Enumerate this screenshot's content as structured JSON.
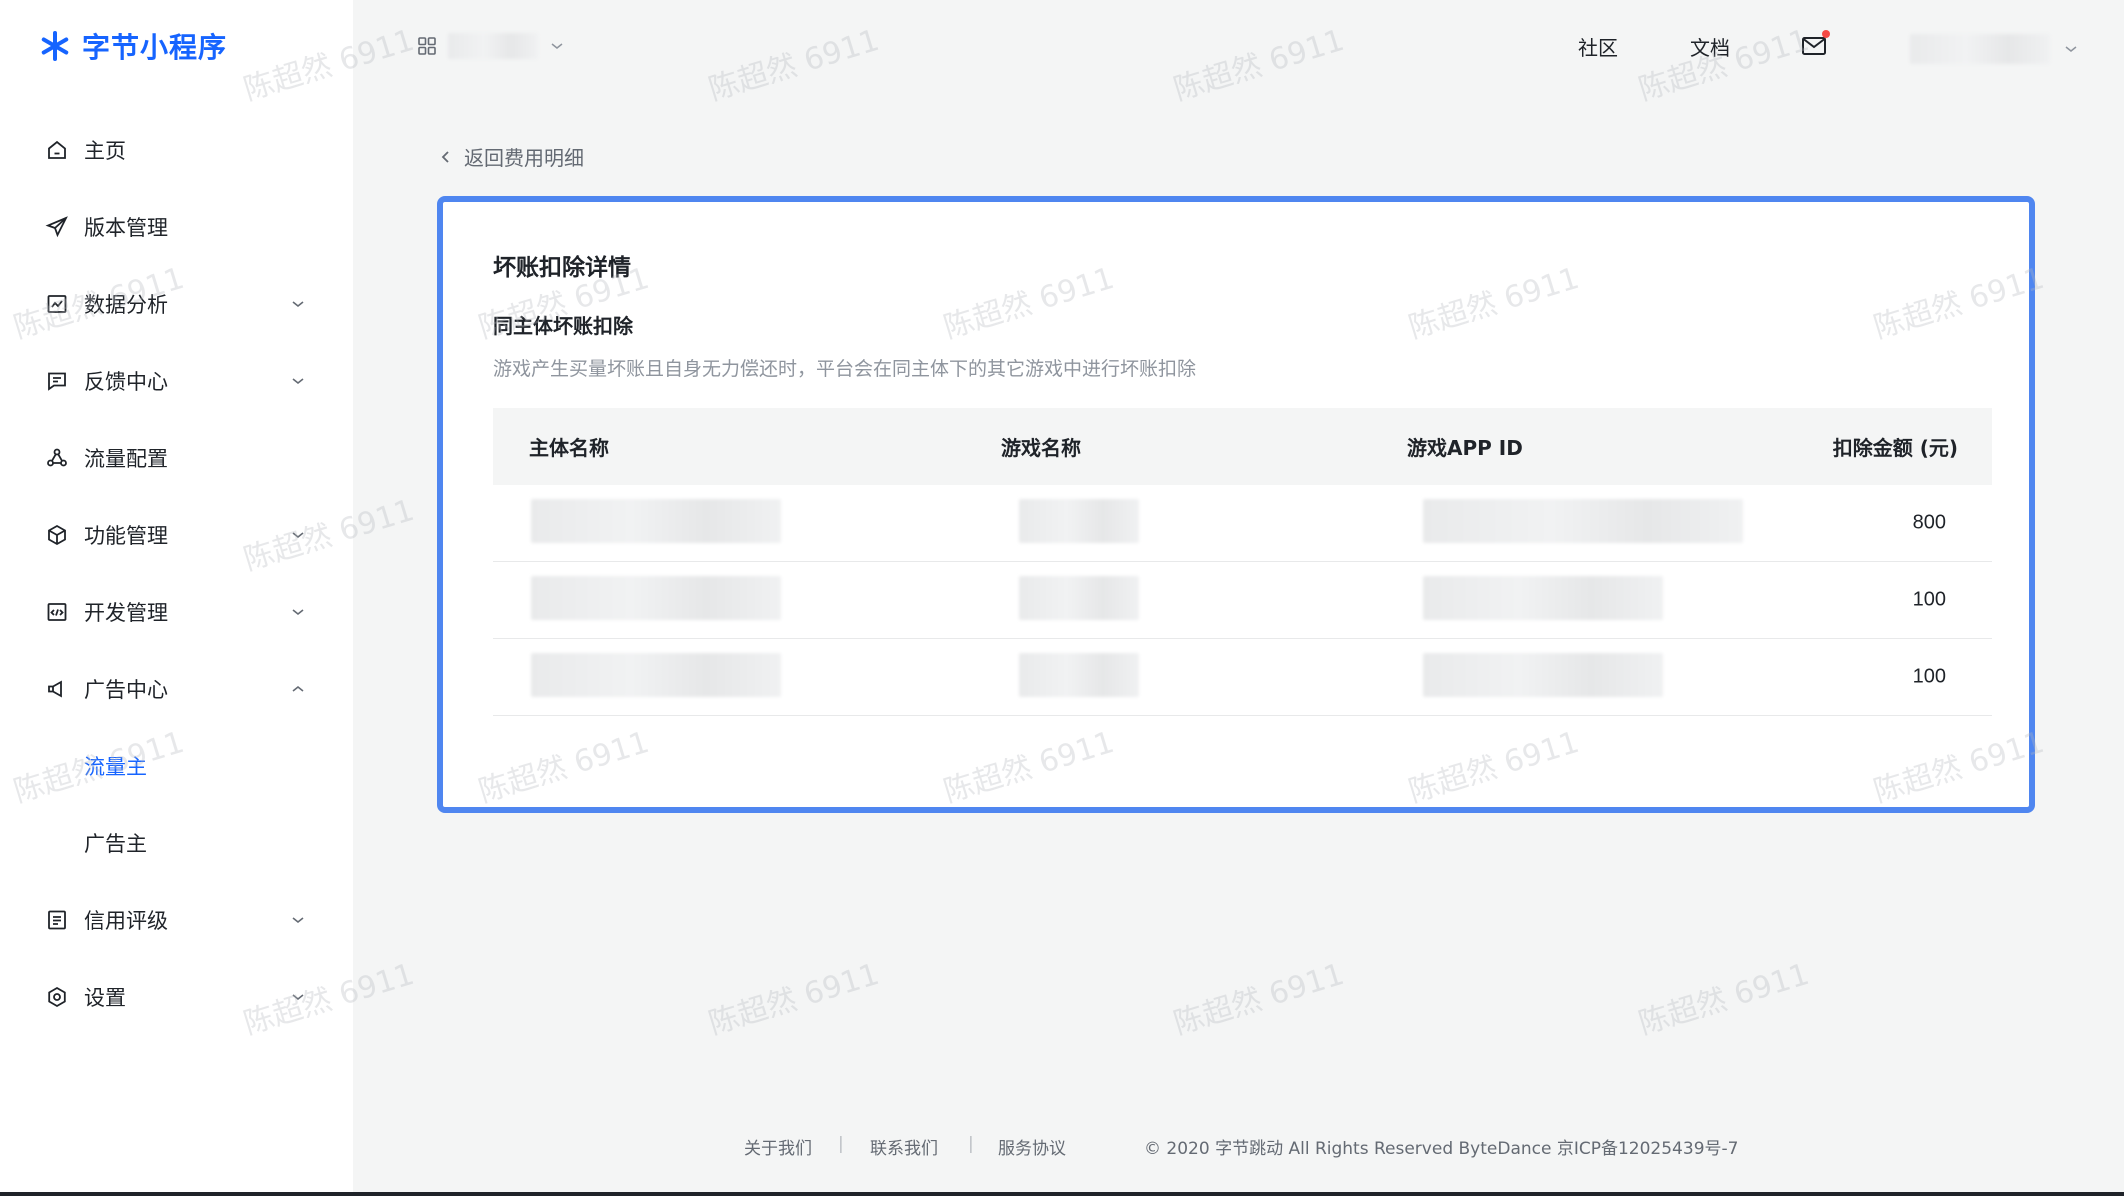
{
  "brand": {
    "name": "字节小程序",
    "accent_color": "#1664ff"
  },
  "sidebar": {
    "items": [
      {
        "label": "主页",
        "icon": "home-icon",
        "expandable": false
      },
      {
        "label": "版本管理",
        "icon": "send-icon",
        "expandable": false
      },
      {
        "label": "数据分析",
        "icon": "chart-icon",
        "expandable": true,
        "expanded": false
      },
      {
        "label": "反馈中心",
        "icon": "message-icon",
        "expandable": true,
        "expanded": false
      },
      {
        "label": "流量配置",
        "icon": "traffic-icon",
        "expandable": false
      },
      {
        "label": "功能管理",
        "icon": "cube-icon",
        "expandable": true,
        "expanded": false
      },
      {
        "label": "开发管理",
        "icon": "code-icon",
        "expandable": true,
        "expanded": false
      },
      {
        "label": "广告中心",
        "icon": "megaphone-icon",
        "expandable": true,
        "expanded": true
      },
      {
        "label": "流量主",
        "sub": true,
        "active": true
      },
      {
        "label": "广告主",
        "sub": true,
        "active": false
      },
      {
        "label": "信用评级",
        "icon": "list-icon",
        "expandable": true,
        "expanded": false
      },
      {
        "label": "设置",
        "icon": "settings-icon",
        "expandable": true,
        "expanded": false
      }
    ]
  },
  "topbar": {
    "community": "社区",
    "docs": "文档",
    "has_unread_mail": true
  },
  "main": {
    "back_label": "返回费用明细",
    "card": {
      "title": "坏账扣除详情",
      "subtitle": "同主体坏账扣除",
      "description": "游戏产生买量坏账且自身无力偿还时，平台会在同主体下的其它游戏中进行坏账扣除",
      "columns": [
        "主体名称",
        "游戏名称",
        "游戏APP ID",
        "扣除金额 (元)"
      ],
      "rows": [
        {
          "amount": "800"
        },
        {
          "amount": "100"
        },
        {
          "amount": "100"
        }
      ]
    }
  },
  "footer": {
    "about": "关于我们",
    "contact": "联系我们",
    "terms": "服务协议",
    "separator": "|",
    "copyright": "© 2020 字节跳动 All Rights Reserved ByteDance 京ICP备12025439号-7"
  },
  "watermark": "陈超然 6911",
  "colors": {
    "highlight_border": "#4f86f0",
    "active_nav": "#1664ff",
    "unread_dot": "#f54a45"
  }
}
